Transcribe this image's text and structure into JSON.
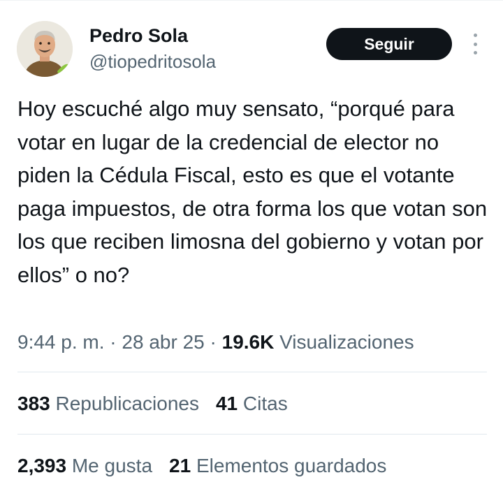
{
  "author": {
    "name": "Pedro Sola",
    "handle": "@tiopedritosola"
  },
  "actions": {
    "follow_label": "Seguir",
    "more_icon": "more-vertical-icon"
  },
  "tweet": {
    "text": "Hoy escuché algo muy sensato, “porqué para votar en lugar de la credencial de elector no piden la Cédula Fiscal, esto es que el votante paga impuestos, de otra forma los que votan son los que reciben limosna del gobierno y votan por ellos” o no?",
    "time": "9:44 p. m.",
    "date": "28 abr 25",
    "separator": "·",
    "views_count": "19.6K",
    "views_label": "Visualizaciones"
  },
  "stats": {
    "reposts_count": "383",
    "reposts_label": "Republicaciones",
    "quotes_count": "41",
    "quotes_label": "Citas",
    "likes_count": "2,393",
    "likes_label": "Me gusta",
    "bookmarks_count": "21",
    "bookmarks_label": "Elementos guardados"
  },
  "colors": {
    "text": "#0f1419",
    "secondary": "#536471",
    "button_bg": "#0f1419",
    "divider": "#e1e8ed"
  }
}
